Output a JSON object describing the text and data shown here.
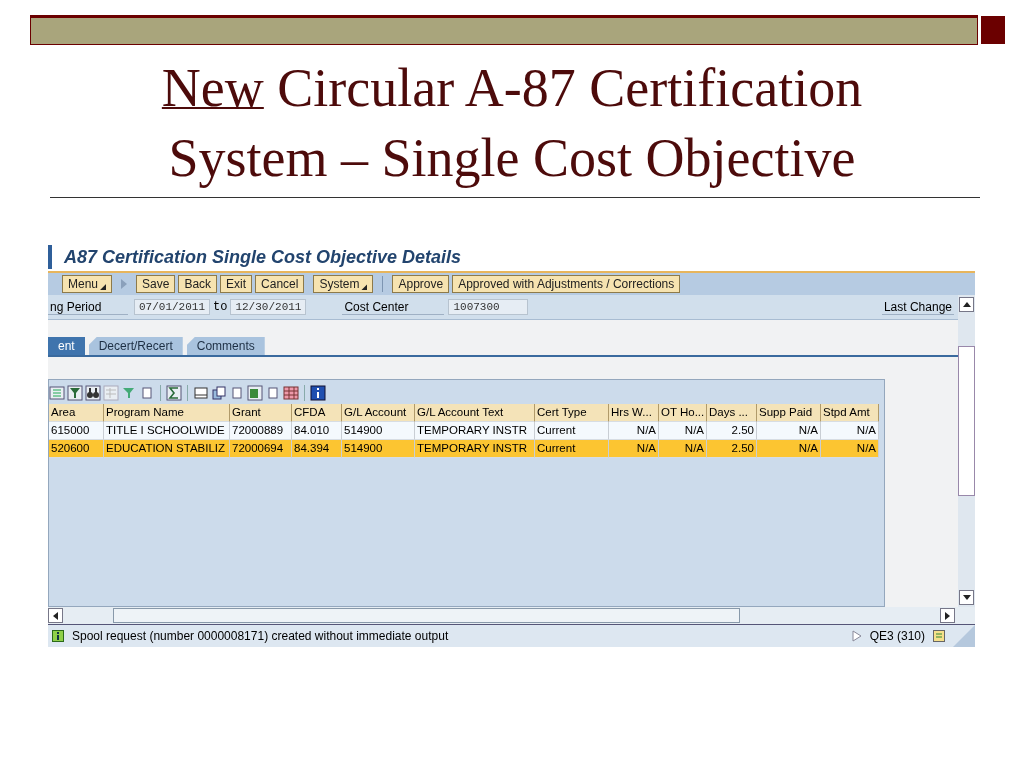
{
  "slide": {
    "title_underlined": "New",
    "title_rest": "Circular A-87 Certification System – Single Cost Objective"
  },
  "window": {
    "title": "A87 Certification Single Cost Objective Details"
  },
  "toolbar": {
    "menu": "Menu",
    "buttons": [
      "Save",
      "Back",
      "Exit",
      "Cancel"
    ],
    "system": "System",
    "actions": [
      "Approve",
      "Approved with Adjustments / Corrections"
    ]
  },
  "fields": {
    "period_label": "ng Period",
    "from": "07/01/2011",
    "to_label": "to",
    "to": "12/30/2011",
    "cost_center_label": "Cost Center",
    "cost_center": "1007300",
    "last_change_label": "Last Change"
  },
  "tabs": [
    {
      "label": "ent",
      "selected": true
    },
    {
      "label": "Decert/Recert",
      "selected": false
    },
    {
      "label": "Comments",
      "selected": false
    }
  ],
  "table": {
    "columns": [
      "Area",
      "Program Name",
      "Grant",
      "CFDA",
      "G/L Account",
      "G/L Account Text",
      "Cert Type",
      "Hrs W...",
      "OT Ho...",
      "Days ...",
      "Supp Paid",
      "Stpd Amt"
    ],
    "rows": [
      {
        "selected": false,
        "cells": [
          "615000",
          "TITLE I SCHOOLWIDE",
          "72000889",
          "84.010",
          "514900",
          "TEMPORARY INSTR",
          "Current",
          "N/A",
          "N/A",
          "2.50",
          "N/A",
          "N/A"
        ]
      },
      {
        "selected": true,
        "cells": [
          "520600",
          "EDUCATION STABILIZ",
          "72000694",
          "84.394",
          "514900",
          "TEMPORARY INSTR",
          "Current",
          "N/A",
          "N/A",
          "2.50",
          "N/A",
          "N/A"
        ]
      }
    ]
  },
  "status_bar": {
    "message": "Spool request (number 0000008171) created without immediate output",
    "system": "QE3 (310)"
  }
}
